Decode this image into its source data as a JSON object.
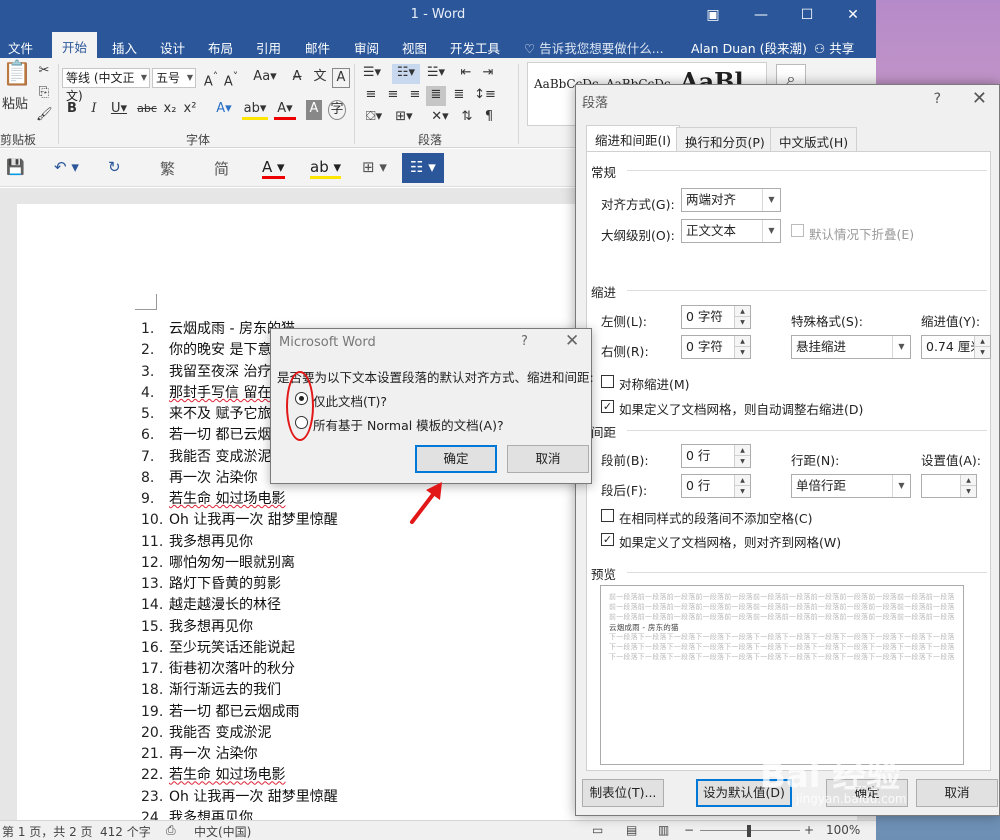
{
  "window": {
    "title": "1 - Word"
  },
  "ribbon_tabs": [
    "文件",
    "开始",
    "插入",
    "设计",
    "布局",
    "引用",
    "邮件",
    "审阅",
    "视图",
    "开发工具"
  ],
  "tell_me": "告诉我您想要做什么...",
  "user": "Alan Duan (段来潮)",
  "share": "共享",
  "ribbon": {
    "paste": "粘贴",
    "clipboard": "剪贴板",
    "font_name": "等线 (中文正文)",
    "font_size": "五号",
    "font_group": "字体",
    "para_group": "段落",
    "styles_preview": [
      "AaBbCcDc",
      "AaBbCcDc",
      "AaBl"
    ]
  },
  "qat": {
    "trad": "繁",
    "simp": "简"
  },
  "list_items": [
    {
      "num": "1.",
      "text": "云烟成雨 - 房东的猫"
    },
    {
      "num": "2.",
      "text": "你的晚安 是下意"
    },
    {
      "num": "3.",
      "text": "我留至夜深 治疗"
    },
    {
      "num": "4.",
      "text": "那封手写信 留在"
    },
    {
      "num": "5.",
      "text": "来不及 赋予它旅"
    },
    {
      "num": "6.",
      "text": "若一切 都已云烟"
    },
    {
      "num": "7.",
      "text": "我能否 变成淤泥"
    },
    {
      "num": "8.",
      "text": "再一次 沾染你"
    },
    {
      "num": "9.",
      "text": "若生命 如过场电影"
    },
    {
      "num": "10.",
      "text": "Oh 让我再一次 甜梦里惊醒"
    },
    {
      "num": "11.",
      "text": "我多想再见你"
    },
    {
      "num": "12.",
      "text": "哪怕匆匆一眼就别离"
    },
    {
      "num": "13.",
      "text": "路灯下昏黄的剪影"
    },
    {
      "num": "14.",
      "text": "越走越漫长的林径"
    },
    {
      "num": "15.",
      "text": "我多想再见你"
    },
    {
      "num": "16.",
      "text": "至少玩笑话还能说起"
    },
    {
      "num": "17.",
      "text": "街巷初次落叶的秋分"
    },
    {
      "num": "18.",
      "text": "渐行渐远去的我们"
    },
    {
      "num": "19.",
      "text": "若一切 都已云烟成雨"
    },
    {
      "num": "20.",
      "text": "我能否 变成淤泥"
    },
    {
      "num": "21.",
      "text": "再一次 沾染你"
    },
    {
      "num": "22.",
      "text": "若生命 如过场电影"
    },
    {
      "num": "23.",
      "text": "Oh 让我再一次 甜梦里惊醒"
    },
    {
      "num": "24.",
      "text": "我多想再见你"
    }
  ],
  "statusbar": {
    "page": "第 1 页，共 2 页",
    "words": "412 个字",
    "lang": "中文(中国)",
    "zoom": "100%"
  },
  "para_dialog": {
    "title": "段落",
    "tabs": [
      "缩进和间距(I)",
      "换行和分页(P)",
      "中文版式(H)"
    ],
    "general": "常规",
    "align_label": "对齐方式(G):",
    "align_value": "两端对齐",
    "outline_label": "大纲级别(O):",
    "outline_value": "正文文本",
    "collapse_label": "默认情况下折叠(E)",
    "indent": "缩进",
    "left_label": "左侧(L):",
    "left_value": "0 字符",
    "right_label": "右侧(R):",
    "right_value": "0 字符",
    "special_label": "特殊格式(S):",
    "special_value": "悬挂缩进",
    "indent_by_label": "缩进值(Y):",
    "indent_by_value": "0.74 厘米",
    "mirror_label": "对称缩进(M)",
    "auto_right_label": "如果定义了文档网格，则自动调整右缩进(D)",
    "spacing": "间距",
    "before_label": "段前(B):",
    "before_value": "0 行",
    "after_label": "段后(F):",
    "after_value": "0 行",
    "line_label": "行距(N):",
    "line_value": "单倍行距",
    "at_label": "设置值(A):",
    "at_value": "",
    "no_space_label": "在相同样式的段落间不添加空格(C)",
    "snap_grid_label": "如果定义了文档网格，则对齐到网格(W)",
    "preview": "预览",
    "preview_prev": "前一段落前一段落前一段落前一段落前一段落前一段落前一段落前一段落前一段落前一段落前一段落前一段落",
    "preview_sample": "云烟成雨 - 房东的猫",
    "preview_next": "下一段落下一段落下一段落下一段落下一段落下一段落下一段落下一段落下一段落下一段落下一段落下一段落",
    "tabs_btn": "制表位(T)...",
    "default_btn": "设为默认值(D)",
    "ok_btn": "确定",
    "cancel_btn": "取消"
  },
  "msword_dialog": {
    "title": "Microsoft Word",
    "question": "是否要为以下文本设置段落的默认对齐方式、缩进和间距:",
    "opt_this": "仅此文档(T)?",
    "opt_all": "所有基于 Normal 模板的文档(A)?",
    "ok": "确定",
    "cancel": "取消"
  },
  "watermark": {
    "brand": "Bai 经验",
    "url": "jingyan.baidu.com"
  },
  "colors": {
    "word_blue": "#2b579a",
    "annotation_red": "#e21818",
    "focus_blue": "#0078d7"
  }
}
